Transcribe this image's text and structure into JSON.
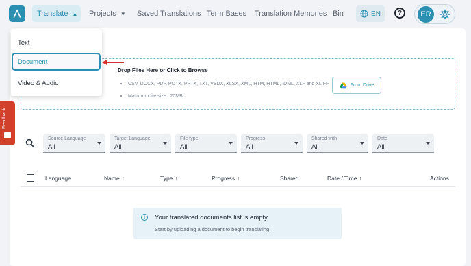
{
  "nav": {
    "translate": "Translate",
    "projects": "Projects",
    "saved": "Saved Translations",
    "termbases": "Term Bases",
    "tm": "Translation Memories",
    "bin": "Bin",
    "lang": "EN",
    "help": "?",
    "avatar": "ER"
  },
  "menu": {
    "items": [
      "Text",
      "Document",
      "Video & Audio"
    ],
    "selected": "Document"
  },
  "upload": {
    "title": "Drop Files Here or Click to Browse",
    "formats": "CSV, DOCX, PDF, POTX, PPTX, TXT, VSDX, XLSX, XML, HTM, HTML, IDML, XLF and XLIFF",
    "max_size": "Maximum file size:: 20MB",
    "drive_button": "From Drive"
  },
  "feedback": "Feedback",
  "filters": [
    {
      "label": "Source Language",
      "value": "All"
    },
    {
      "label": "Target Language",
      "value": "All"
    },
    {
      "label": "File type",
      "value": "All"
    },
    {
      "label": "Progress",
      "value": "All"
    },
    {
      "label": "Shared with",
      "value": "All"
    },
    {
      "label": "Date",
      "value": "All"
    }
  ],
  "table": {
    "headers": {
      "language": "Language",
      "name": "Name",
      "type": "Type",
      "progress": "Progress",
      "shared": "Shared",
      "datetime": "Date / Time",
      "actions": "Actions"
    }
  },
  "empty": {
    "title": "Your translated documents list is empty.",
    "subtitle": "Start by uploading a document to begin translating."
  },
  "colors": {
    "accent": "#2a8fb0",
    "feedback": "#d0402b",
    "annotation_arrow": "#d32f2f"
  }
}
